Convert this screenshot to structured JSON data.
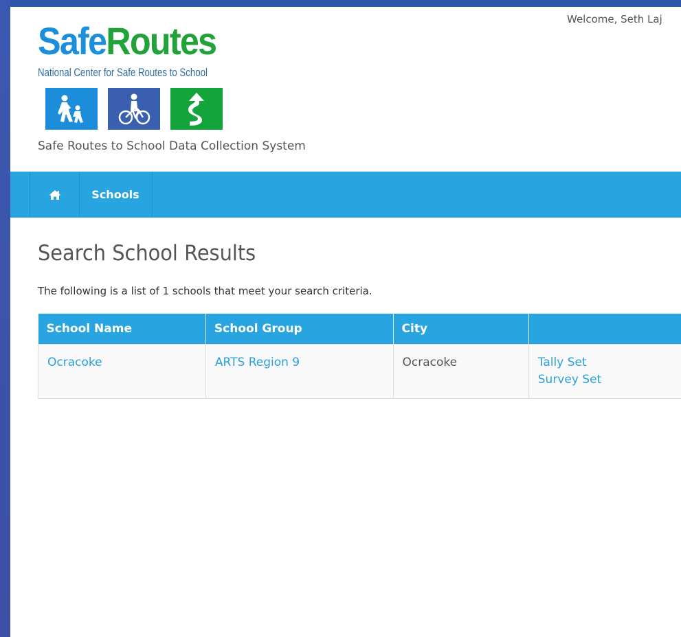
{
  "header": {
    "welcome": "Welcome, Seth Laj",
    "logo": {
      "word_a": "Safe",
      "word_b": "Routes",
      "subtitle": "National Center for Safe Routes to School"
    },
    "system_title": "Safe Routes to School Data Collection System",
    "tiles": [
      "walking-icon",
      "bicycle-icon",
      "route-icon"
    ]
  },
  "nav": {
    "home_icon": "home-icon",
    "schools_label": "Schools"
  },
  "main": {
    "title": "Search School Results",
    "summary": "The following is a list of 1 schools that meet your search criteria.",
    "table": {
      "headers": [
        "School Name",
        "School Group",
        "City",
        ""
      ],
      "rows": [
        {
          "name": "Ocracoke",
          "group": "ARTS Region 9",
          "city": "Ocracoke",
          "links": [
            "Tally Set",
            "Survey Set"
          ]
        }
      ]
    }
  },
  "colors": {
    "accent": "#28a4e1",
    "link": "#2aa0dc",
    "logo_blue": "#1b8fd9",
    "logo_green": "#21a33a"
  }
}
